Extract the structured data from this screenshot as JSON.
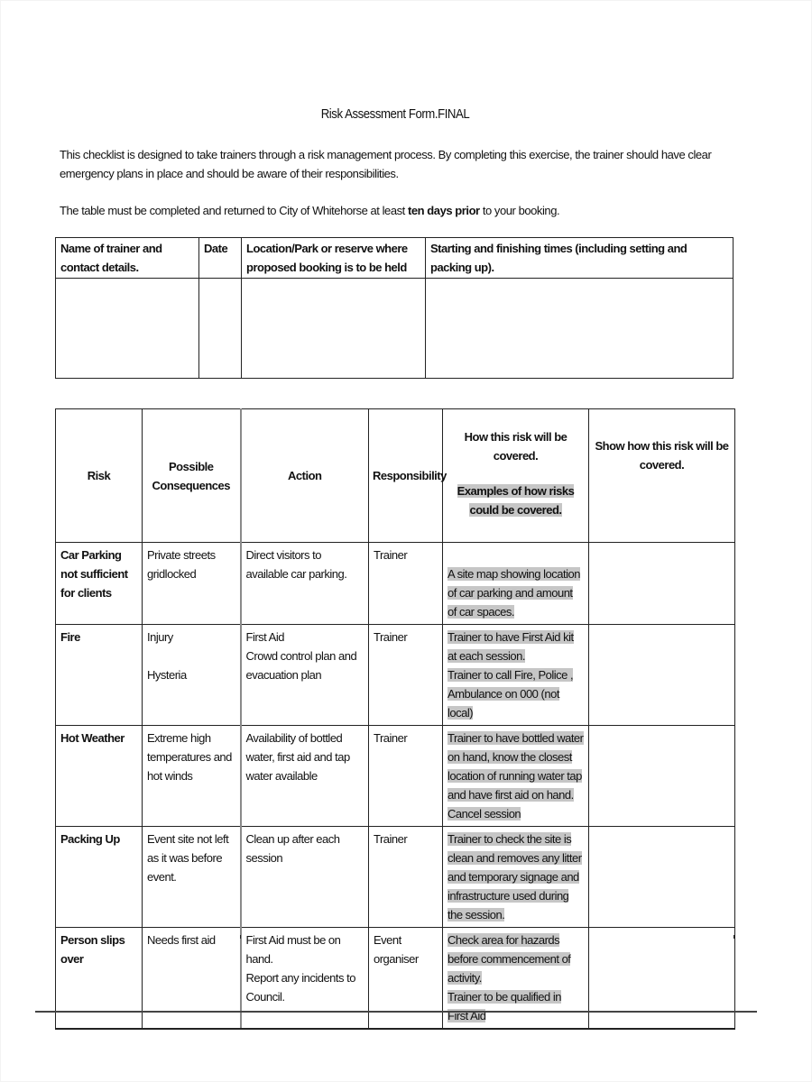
{
  "document": {
    "title": "Risk Assessment Form.FINAL",
    "intro": "This checklist is designed to take trainers through a risk management process.  By completing this exercise, the trainer should have clear emergency plans in place and should be aware of their responsibilities.",
    "instruction": {
      "before": "The table must be completed and returned to City of Whitehorse at least ",
      "bold": "ten days prior",
      "after": " to your booking."
    }
  },
  "info_table": {
    "headers": [
      "Name of trainer and contact details.",
      "Date",
      "Location/Park or reserve where proposed booking is to be held",
      "Starting and finishing times (including setting and packing up)."
    ],
    "values": [
      "",
      "",
      "",
      ""
    ]
  },
  "risk_table": {
    "headers": {
      "risk": "Risk",
      "consequences": "Possible Consequences",
      "action": "Action",
      "responsibility": "Responsibility",
      "covered": "How this risk will be covered.",
      "covered_examples": "Examples of how risks could be covered.",
      "show": "Show how this risk will be covered."
    },
    "rows": [
      {
        "risk": "Car Parking not sufficient for clients",
        "consequences": [
          "Private streets gridlocked"
        ],
        "action": [
          "Direct visitors to available car parking."
        ],
        "responsibility": "Trainer",
        "examples": [
          "A site map showing location of car parking and amount of car spaces."
        ],
        "show": ""
      },
      {
        "risk": "Fire",
        "consequences": [
          "Injury",
          "Hysteria"
        ],
        "action": [
          "First Aid",
          "Crowd control plan and evacuation plan"
        ],
        "responsibility": "Trainer",
        "examples": [
          "Trainer to have First Aid kit at each session.",
          "Trainer to call Fire, Police , Ambulance on 000 (not local)"
        ],
        "show": ""
      },
      {
        "risk": "Hot Weather",
        "consequences": [
          "Extreme high temperatures and hot winds"
        ],
        "action": [
          "Availability of bottled water, first aid and tap water available"
        ],
        "responsibility": "Trainer",
        "examples": [
          "Trainer to have bottled water on hand, know the closest location of running water tap and have first aid on hand.",
          "Cancel session"
        ],
        "show": ""
      },
      {
        "risk": "Packing Up",
        "consequences": [
          "Event site not left as it was before event."
        ],
        "action": [
          "Clean up after each session"
        ],
        "responsibility": "Trainer",
        "examples": [
          "Trainer to check the site is clean and removes any litter and temporary signage and infrastructure used during the session."
        ],
        "show": ""
      },
      {
        "risk": "Person slips over",
        "consequences": [
          "Needs first aid"
        ],
        "action": [
          "First Aid must be on hand.",
          "Report any incidents to Council."
        ],
        "responsibility": "Event organiser",
        "examples": [
          "Check area for hazards before commencement of activity.",
          "Trainer to be qualified in First Aid"
        ],
        "show": ""
      }
    ]
  },
  "colors": {
    "highlight": "#c6c6c6",
    "border": "#222222"
  }
}
